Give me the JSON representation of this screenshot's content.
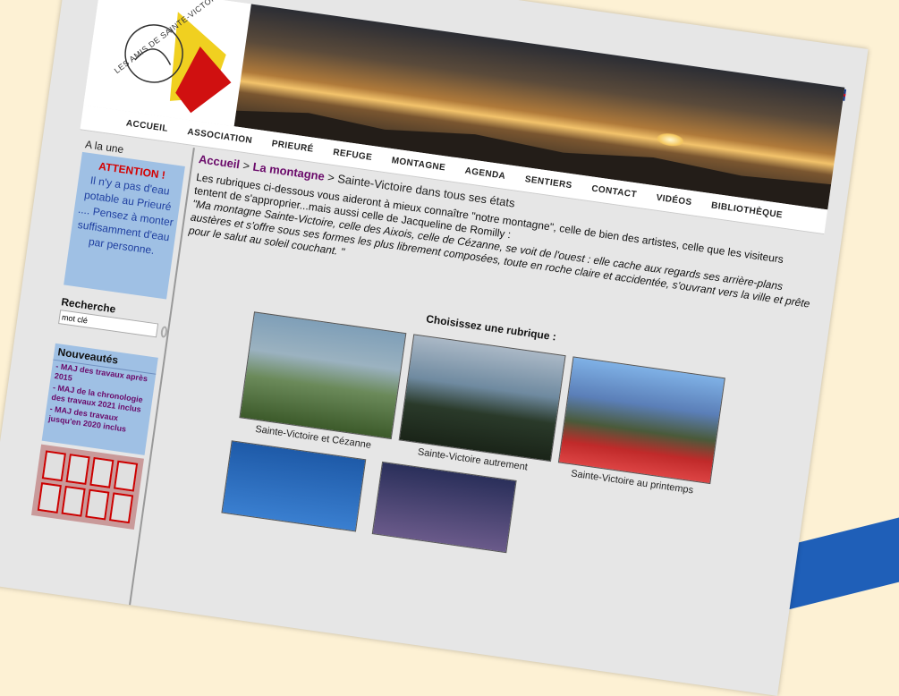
{
  "logo": {
    "text": "LES AMIS DE SAINTE-VICTOIRE"
  },
  "nav": [
    "ACCUEIL",
    "ASSOCIATION",
    "PRIEURÉ",
    "REFUGE",
    "MONTAGNE",
    "AGENDA",
    "SENTIERS",
    "CONTACT",
    "VIDÉOS",
    "BIBLIOTHÈQUE"
  ],
  "sidebar": {
    "alaune_title": "A la une",
    "attention": "ATTENTION !",
    "alert": "Il n'y a pas d'eau potable au Prieuré .... Pensez à monter suffisamment d'eau par personne.",
    "search_label": "Recherche",
    "search_value": "mot clé",
    "news_title": "Nouveautés",
    "news_items": [
      "- MAJ des travaux après 2015",
      "- MAJ de la chronologie des travaux 2021 inclus",
      "- MAJ des travaux jusqu'en 2020 inclus"
    ]
  },
  "breadcrumb": {
    "home": "Accueil",
    "section": "La montagne",
    "current": "Sainte-Victoire dans tous ses états",
    "sep": ">"
  },
  "intro": "Les rubriques ci-dessous vous aideront à mieux connaître \"notre montagne\", celle de bien des artistes, celle que les visiteurs tentent de s'approprier...mais aussi celle de Jacqueline de Romilly :",
  "quote": "\"Ma montagne Sainte-Victoire, celle des Aixois, celle de Cézanne, se voit de l'ouest : elle cache aux regards ses arrière-plans austères et s'offre sous ses formes les plus librement composées, toute en roche claire et accidentée, s'ouvrant vers la ville et prête pour le salut au soleil couchant. \"",
  "choose": "Choisissez une rubrique :",
  "gallery": [
    {
      "caption": "Sainte-Victoire et Cézanne"
    },
    {
      "caption": "Sainte-Victoire autrement"
    },
    {
      "caption": "Sainte-Victoire au printemps"
    }
  ],
  "colors": {
    "accent": "#6a0a6a",
    "alert": "#d40000",
    "panel": "#9fc0e4"
  }
}
